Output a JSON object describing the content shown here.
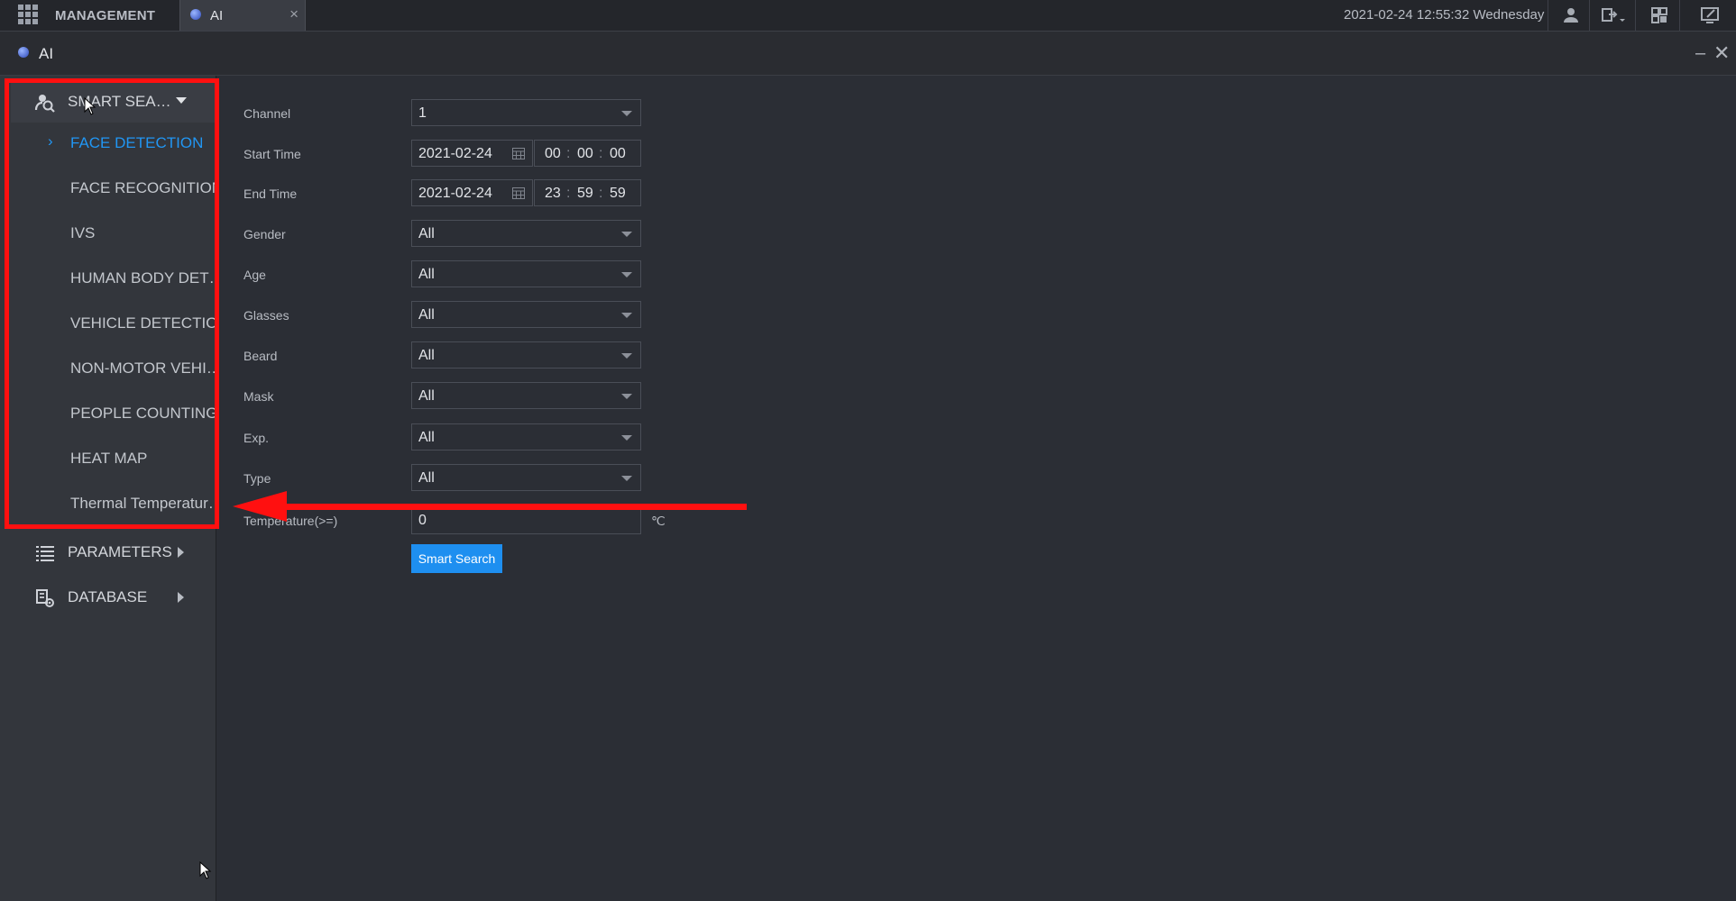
{
  "topbar": {
    "management_label": "MANAGEMENT",
    "tab_label": "AI",
    "tab_close": "×",
    "datetime": "2021-02-24 12:55:32 Wednesday"
  },
  "window": {
    "title": "AI",
    "minimize": "–",
    "close": "✕"
  },
  "sidebar": {
    "smart_search": {
      "label": "SMART SEA…",
      "icon": "search-person-icon"
    },
    "items": [
      {
        "label": "FACE DETECTION",
        "active": true
      },
      {
        "label": "FACE RECOGNITION",
        "active": false
      },
      {
        "label": "IVS",
        "active": false
      },
      {
        "label": "HUMAN BODY DET…",
        "active": false
      },
      {
        "label": "VEHICLE DETECTION",
        "active": false
      },
      {
        "label": "NON-MOTOR VEHI…",
        "active": false
      },
      {
        "label": "PEOPLE COUNTING",
        "active": false
      },
      {
        "label": "HEAT MAP",
        "active": false
      },
      {
        "label": "Thermal Temperatur…",
        "active": false
      }
    ],
    "parameters": {
      "label": "PARAMETERS",
      "icon": "list-icon"
    },
    "database": {
      "label": "DATABASE",
      "icon": "database-icon"
    }
  },
  "form": {
    "channel": {
      "label": "Channel",
      "value": "1"
    },
    "start_time": {
      "label": "Start Time",
      "date": "2021-02-24",
      "hh": "00",
      "mm": "00",
      "ss": "00"
    },
    "end_time": {
      "label": "End Time",
      "date": "2021-02-24",
      "hh": "23",
      "mm": "59",
      "ss": "59"
    },
    "gender": {
      "label": "Gender",
      "value": "All"
    },
    "age": {
      "label": "Age",
      "value": "All"
    },
    "glasses": {
      "label": "Glasses",
      "value": "All"
    },
    "beard": {
      "label": "Beard",
      "value": "All"
    },
    "mask": {
      "label": "Mask",
      "value": "All"
    },
    "exp": {
      "label": "Exp.",
      "value": "All"
    },
    "type": {
      "label": "Type",
      "value": "All"
    },
    "temperature": {
      "label": "Temperature(>=)",
      "value": "0",
      "unit": "℃"
    },
    "search_button": "Smart Search"
  },
  "colors": {
    "accent": "#2196f3",
    "annotation_red": "#ff1010",
    "background": "#2b2e35",
    "sidebar": "#33363c"
  }
}
